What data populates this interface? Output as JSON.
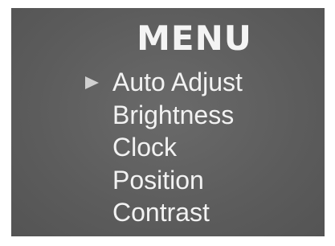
{
  "menu": {
    "title": "MENU",
    "selected_index": 0,
    "items": [
      {
        "label": "Auto Adjust"
      },
      {
        "label": "Brightness"
      },
      {
        "label": "Clock"
      },
      {
        "label": "Position"
      },
      {
        "label": "Contrast"
      }
    ]
  },
  "colors": {
    "panel_background": "#5e5e5e",
    "text": "#f2f2f2",
    "pointer": "#d0d0d0"
  },
  "icons": {
    "selection_pointer": "triangle-right-icon"
  }
}
